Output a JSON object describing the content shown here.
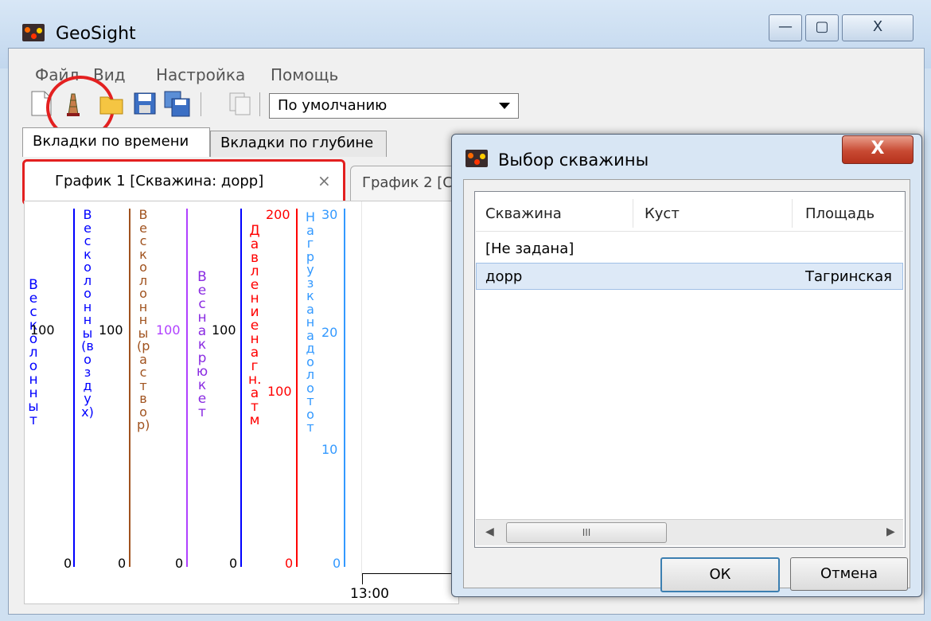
{
  "app": {
    "title": "GeoSight"
  },
  "menu": [
    "Файл",
    "Вид",
    "Настройка",
    "Помощь"
  ],
  "toolbar": {
    "preset_value": "По умолчанию"
  },
  "outer_tabs": [
    "Вкладки по времени",
    "Вкладки по глубине"
  ],
  "chart_tabs": [
    {
      "label": "График 1 [Скважина: дорр]",
      "close": "×"
    },
    {
      "label": "График 2 [С"
    }
  ],
  "chart": {
    "axes": [
      {
        "label": "Вес колонны т",
        "color": "#0000ff",
        "max": "100",
        "min": ""
      },
      {
        "label": "Вес колонны (воздух)",
        "color": "#0000ff",
        "max": "100",
        "min": "0"
      },
      {
        "label": "Вес колонны (раствор)",
        "color": "#a0521e",
        "max": "100",
        "min": "0"
      },
      {
        "label": "",
        "color": "#b040ff",
        "max": "100",
        "min": "0"
      },
      {
        "label": "Вес на крюке т",
        "color": "#8a2be2",
        "max": "100",
        "min": "0"
      },
      {
        "label": "Давление нагн. атм",
        "color": "#ff0000",
        "max": "200",
        "mid": "100",
        "min": "0"
      },
      {
        "label": "Нагрузка на долото т",
        "color": "#3399ff",
        "max": "30",
        "mid1": "20",
        "mid2": "10",
        "min": "0"
      }
    ],
    "xtick": "13:00"
  },
  "dialog": {
    "title": "Выбор скважины",
    "close": "X",
    "columns": [
      "Скважина",
      "Куст",
      "Площадь"
    ],
    "rows": [
      {
        "well": "[Не задана]",
        "cluster": "",
        "area": ""
      },
      {
        "well": "дорр",
        "cluster": "",
        "area": "Тагринская"
      }
    ],
    "scroll_thumb": "III",
    "ok": "ОК",
    "cancel": "Отмена"
  }
}
